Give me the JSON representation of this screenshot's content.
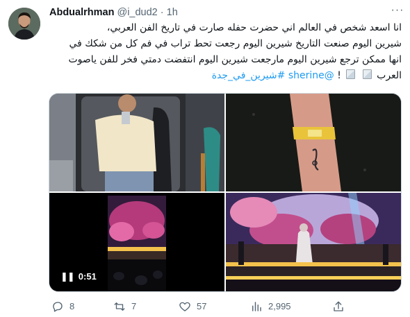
{
  "tweet": {
    "author_name": "Abdualrhman",
    "handle": "@i_dud2",
    "separator": "·",
    "time": "1h",
    "more_label": "···",
    "text_lines": [
      "انا اسعد شخص في العالم اني حضرت حفله صارت في تاريخ الفن العربي،",
      "شيرين اليوم صنعت التاريخ شيرين اليوم رجعت تحط تراب في فم كل من شكك في",
      "انها ممكن ترجع شيرين اليوم مارجعت شيرين اليوم انتفضت دمتي فخر للفن ياصوت"
    ],
    "last_line_word": "العرب",
    "exclamation": "!",
    "mention": "@sherine",
    "hashtag": "#شيرين_في_جدة"
  },
  "media": {
    "video_duration": "0:51",
    "pause_icon": "pause-icon",
    "images": [
      "mirror-selfie-image",
      "wrist-tattoo-image",
      "concert-video-thumbnail",
      "concert-stage-image"
    ]
  },
  "actions": {
    "replies": "8",
    "retweets": "7",
    "likes": "57",
    "views": "2,995"
  },
  "colors": {
    "link": "#1d9bf0",
    "text": "#0f1419",
    "secondary": "#536471",
    "border": "#cfd9de"
  }
}
